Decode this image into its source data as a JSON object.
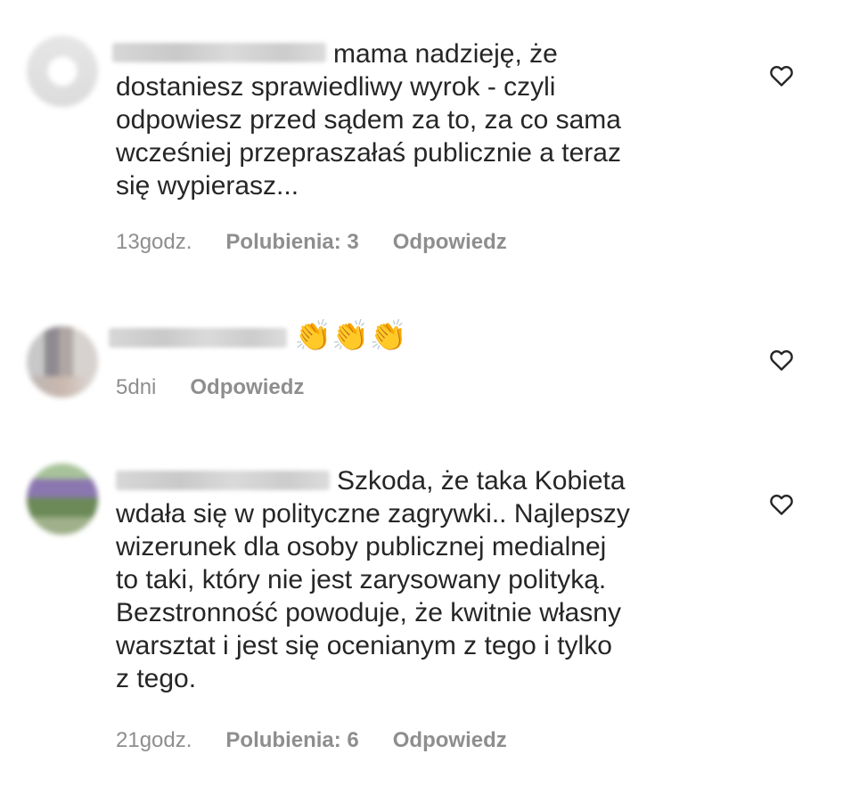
{
  "comments": [
    {
      "text": "mama nadzieję, że\ndostaniesz sprawiedliwy wyrok - czyli\nodpowiesz przed sądem za to, za co sama\nwcześniej przepraszałaś publicznie a teraz\nsię wypierasz...",
      "time": "13godz.",
      "likes": "Polubienia: 3",
      "reply": "Odpowiedz",
      "icon": "heart-outline-icon"
    },
    {
      "text": "👏👏👏",
      "time": "5dni",
      "reply": "Odpowiedz",
      "icon": "heart-outline-icon"
    },
    {
      "text": "Szkoda, że taka Kobieta\nwdała się w polityczne zagrywki.. Najlepszy\nwizerunek dla osoby publicznej medialnej\nto taki, który nie jest zarysowany polityką.\nBezstronność powoduje, że kwitnie własny\nwarsztat i jest się ocenianym z tego i tylko\nz tego.",
      "time": "21godz.",
      "likes": "Polubienia: 6",
      "reply": "Odpowiedz",
      "icon": "heart-outline-icon"
    }
  ]
}
